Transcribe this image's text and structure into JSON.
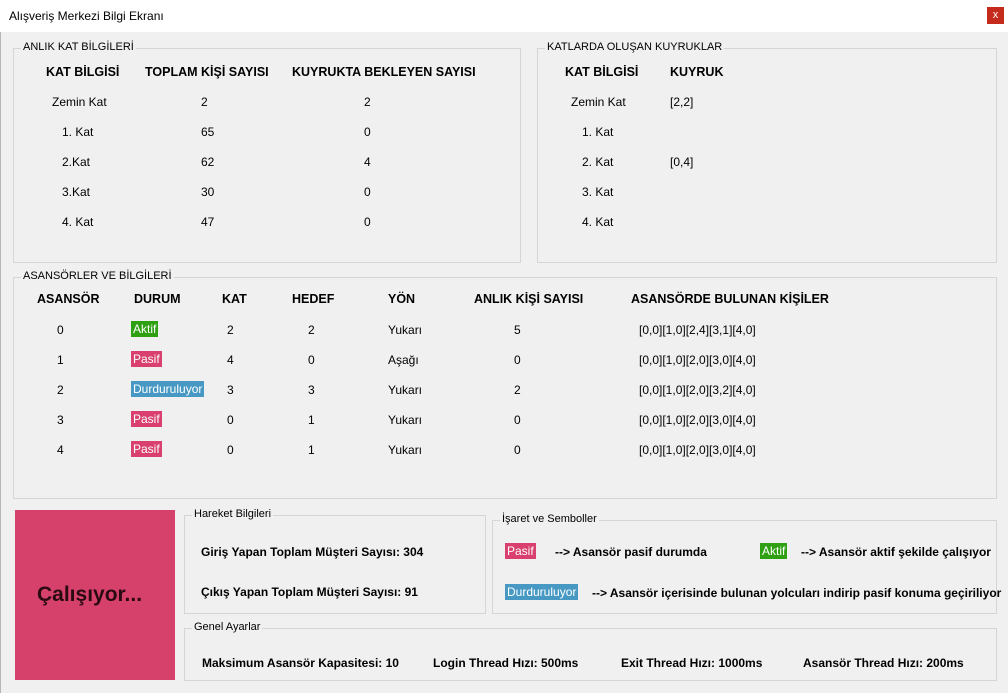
{
  "window": {
    "title": "Alışveriş Merkezi Bilgi Ekranı",
    "close_label": "x"
  },
  "floor_info": {
    "legend": "ANLIK KAT BİLGİLERİ",
    "headers": [
      "KAT BİLGİSİ",
      "TOPLAM KİŞİ SAYISI",
      "KUYRUKTA BEKLEYEN SAYISI"
    ],
    "rows": [
      [
        "Zemin Kat",
        "2",
        "2"
      ],
      [
        "1. Kat",
        "65",
        "0"
      ],
      [
        "2.Kat",
        "62",
        "4"
      ],
      [
        "3.Kat",
        "30",
        "0"
      ],
      [
        "4. Kat",
        "47",
        "0"
      ]
    ]
  },
  "queues": {
    "legend": "KATLARDA OLUŞAN KUYRUKLAR",
    "headers": [
      "KAT BİLGİSİ",
      "KUYRUK"
    ],
    "rows": [
      [
        "Zemin Kat",
        "[2,2]"
      ],
      [
        "1. Kat",
        ""
      ],
      [
        "2. Kat",
        "[0,4]"
      ],
      [
        "3. Kat",
        ""
      ],
      [
        "4. Kat",
        ""
      ]
    ]
  },
  "elevators": {
    "legend": "ASANSÖRLER VE BİLGİLERİ",
    "headers": [
      "ASANSÖR",
      "DURUM",
      "KAT",
      "HEDEF",
      "YÖN",
      "ANLIK KİŞİ SAYISI",
      "ASANSÖRDE BULUNAN KİŞİLER"
    ],
    "rows": [
      [
        "0",
        "Aktif",
        "2",
        "2",
        "Yukarı",
        "5",
        "[0,0][1,0][2,4][3,1][4,0]"
      ],
      [
        "1",
        "Pasif",
        "4",
        "0",
        "Aşağı",
        "0",
        "[0,0][1,0][2,0][3,0][4,0]"
      ],
      [
        "2",
        "Durduruluyor",
        "3",
        "3",
        "Yukarı",
        "2",
        "[0,0][1,0][2,0][3,2][4,0]"
      ],
      [
        "3",
        "Pasif",
        "0",
        "1",
        "Yukarı",
        "0",
        "[0,0][1,0][2,0][3,0][4,0]"
      ],
      [
        "4",
        "Pasif",
        "0",
        "1",
        "Yukarı",
        "0",
        "[0,0][1,0][2,0][3,0][4,0]"
      ]
    ]
  },
  "status": {
    "text": "Çalışıyor..."
  },
  "movement": {
    "legend": "Hareket Bilgileri",
    "entered": "Giriş Yapan Toplam Müşteri Sayısı: 304",
    "exited": "Çıkış Yapan Toplam Müşteri Sayısı: 91"
  },
  "symbols": {
    "legend": "İşaret ve Semboller",
    "pasif_badge": "Pasif",
    "pasif_desc": "--> Asansör pasif durumda",
    "aktif_badge": "Aktif",
    "aktif_desc": "--> Asansör aktif şekilde çalışıyor",
    "durdu_badge": "Durduruluyor",
    "durdu_desc": "--> Asansör içerisinde bulunan yolcuları indirip pasif konuma geçiriliyor"
  },
  "settings": {
    "legend": "Genel Ayarlar",
    "capacity": "Maksimum Asansör Kapasitesi: 10",
    "login_speed": "Login Thread Hızı: 500ms",
    "exit_speed": "Exit Thread Hızı: 1000ms",
    "elevator_speed": "Asansör Thread Hızı: 200ms"
  },
  "colors": {
    "aktif": "#2ea012",
    "pasif": "#d9406f",
    "durduruluyor": "#4799c4",
    "status_panel": "#d6416b",
    "close": "#c42b1c"
  }
}
